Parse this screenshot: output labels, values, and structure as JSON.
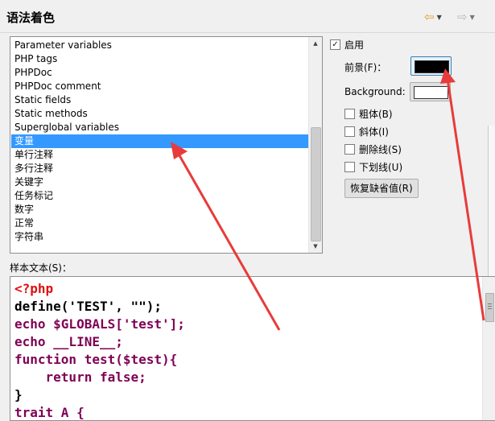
{
  "header": {
    "title": "语法着色",
    "back_icon": "back-arrow-icon",
    "forward_icon": "forward-arrow-icon"
  },
  "element_list": {
    "items": [
      "Parameter variables",
      "PHP tags",
      "PHPDoc",
      "PHPDoc comment",
      "Static fields",
      "Static methods",
      "Superglobal variables",
      "变量",
      "单行注释",
      "多行注释",
      "关键字",
      "任务标记",
      "数字",
      "正常",
      "字符串"
    ],
    "selected": "变量"
  },
  "options": {
    "enable_label": "启用",
    "enable_checked": true,
    "foreground_label": "前景(F)：",
    "foreground_color": "#000000",
    "background_label": "Background:",
    "background_color": "#ffffff",
    "bold_label": "粗体(B)",
    "italic_label": "斜体(I)",
    "strikethrough_label": "删除线(S)",
    "underline_label": "下划线(U)",
    "restore_label": "恢复缺省值(R)"
  },
  "sample": {
    "label": "样本文本(S)：",
    "lines": [
      "<?php",
      "define('TEST', \"\");",
      "echo $GLOBALS['test'];",
      "echo __LINE__;",
      "function test($test){",
      "    return false;",
      "}",
      "trait A {"
    ]
  },
  "colors": {
    "selection": "#3399ff",
    "annotation_arrow": "#e83b3b",
    "keyword": "#7f0055",
    "php_tag": "#e01010",
    "string": "#2a00ff"
  }
}
